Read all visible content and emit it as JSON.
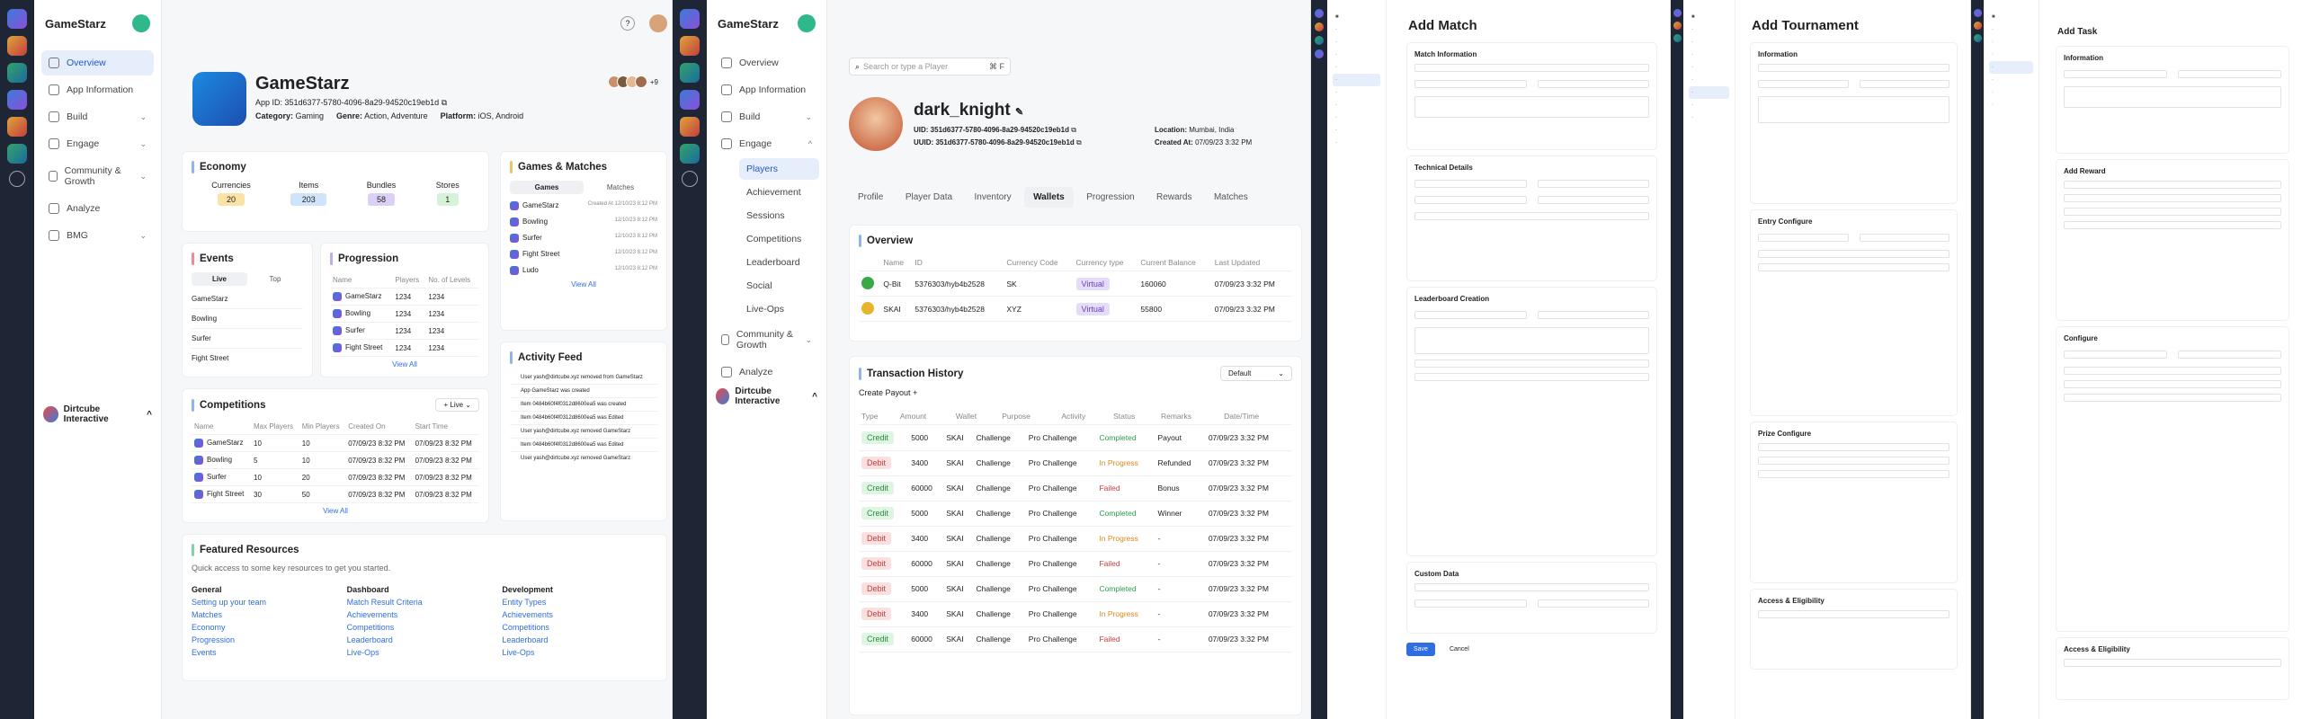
{
  "s1": {
    "brand": "GameStarz",
    "nav": [
      "Overview",
      "App Information",
      "Build",
      "Engage",
      "Community & Growth",
      "Analyze",
      "BMG"
    ],
    "footer": "Dirtcube Interactive",
    "app": {
      "name": "GameStarz",
      "app_id": "App ID: 351d6377-5780-4096-8a29-94520c19eb1d",
      "category_label": "Category:",
      "category": "Gaming",
      "genre_label": "Genre:",
      "genre": "Action, Adventure",
      "platform_label": "Platform:",
      "platform": "iOS, Android",
      "avatars_more": "+9"
    },
    "economy": {
      "title": "Economy",
      "items": [
        {
          "label": "Currencies",
          "value": "20",
          "color": "#fbe3a8"
        },
        {
          "label": "Items",
          "value": "203",
          "color": "#cfe4fb"
        },
        {
          "label": "Bundles",
          "value": "58",
          "color": "#ddd0f7"
        },
        {
          "label": "Stores",
          "value": "1",
          "color": "#d6f3d9"
        }
      ]
    },
    "games": {
      "title": "Games & Matches",
      "tabs": [
        "Games",
        "Matches"
      ],
      "rows": [
        "GameStarz",
        "Bowling",
        "Surfer",
        "Fight Street",
        "Ludo"
      ],
      "dates": [
        "Created At 12/10/23 8:12 PM",
        "12/10/23 8:12 PM",
        "12/10/23 8:12 PM",
        "12/10/23 8:12 PM",
        "12/10/23 8:12 PM"
      ],
      "view_all": "View All"
    },
    "events": {
      "title": "Events",
      "tabs": [
        "Live",
        "Top"
      ],
      "rows": [
        "GameStarz",
        "Bowling",
        "Surfer",
        "Fight Street"
      ]
    },
    "progression": {
      "title": "Progression",
      "cols": [
        "Name",
        "Players",
        "No. of Levels"
      ],
      "rows": [
        [
          "GameStarz",
          "1234",
          "1234"
        ],
        [
          "Bowling",
          "1234",
          "1234"
        ],
        [
          "Surfer",
          "1234",
          "1234"
        ],
        [
          "Fight Street",
          "1234",
          "1234"
        ]
      ],
      "view_all": "View All"
    },
    "activity": {
      "title": "Activity Feed",
      "rows": [
        "User yash@dirtcube.xyz removed from GameStarz",
        "App GameStarz was created",
        "Item 0484b60f4f0312d8600ea5 was created",
        "Item 0484b60f4f0312d8600ea5 was Edited",
        "User yash@dirtcube.xyz removed GameStarz",
        "Item 0484b60f4f0312d8600ea5 was Edited",
        "User yash@dirtcube.xyz removed GameStarz"
      ]
    },
    "competitions": {
      "title": "Competitions",
      "filter": "Live",
      "cols": [
        "Name",
        "Max Players",
        "Min Players",
        "Created On",
        "Start Time"
      ],
      "rows": [
        [
          "GameStarz",
          "10",
          "10",
          "07/09/23 8:32 PM",
          "07/09/23 8:32 PM"
        ],
        [
          "Bowling",
          "5",
          "10",
          "07/09/23 8:32 PM",
          "07/09/23 8:32 PM"
        ],
        [
          "Surfer",
          "10",
          "20",
          "07/09/23 8:32 PM",
          "07/09/23 8:32 PM"
        ],
        [
          "Fight Street",
          "30",
          "50",
          "07/09/23 8:32 PM",
          "07/09/23 8:32 PM"
        ]
      ],
      "view_all": "View All"
    },
    "featured": {
      "title": "Featured Resources",
      "subtitle": "Quick access to some key resources to get you started.",
      "cols": [
        {
          "h": "General",
          "links": [
            "Setting up your team",
            "Matches",
            "Economy",
            "Progression",
            "Events"
          ]
        },
        {
          "h": "Dashboard",
          "links": [
            "Match Result Criteria",
            "Achievements",
            "Competitions",
            "Leaderboard",
            "Live-Ops"
          ]
        },
        {
          "h": "Development",
          "links": [
            "Entity Types",
            "Achievements",
            "Competitions",
            "Leaderboard",
            "Live-Ops"
          ]
        }
      ]
    }
  },
  "s2": {
    "brand": "GameStarz",
    "nav": [
      "Overview",
      "App Information",
      "Build",
      "Engage",
      "Players",
      "Achievement",
      "Sessions",
      "Competitions",
      "Leaderboard",
      "Social",
      "Live-Ops",
      "Community & Growth",
      "Analyze"
    ],
    "footer": "Dirtcube Interactive",
    "search_placeholder": "Search or type a Player",
    "search_kbd": "⌘ F",
    "player": {
      "name": "dark_knight",
      "uid": "UID: 351d6377-5780-4096-8a29-94520c19eb1d",
      "uuid": "UUID: 351d6377-5780-4096-8a29-94520c19eb1d",
      "location_label": "Location:",
      "location": "Mumbai, India",
      "created_label": "Created At:",
      "created": "07/09/23 3:32 PM"
    },
    "tabs": [
      "Profile",
      "Player Data",
      "Inventory",
      "Wallets",
      "Progression",
      "Rewards",
      "Matches"
    ],
    "overview": {
      "title": "Overview",
      "cols": [
        "Name",
        "ID",
        "Currency Code",
        "Currency type",
        "Current Balance",
        "Last Updated"
      ],
      "rows": [
        [
          "Q-Bit",
          "5376303/hyb4b2528",
          "SK",
          "Virtual",
          "160060",
          "07/09/23 3:32 PM"
        ],
        [
          "SKAI",
          "5376303/hyb4b2528",
          "XYZ",
          "Virtual",
          "55800",
          "07/09/23 3:32 PM"
        ]
      ]
    },
    "history": {
      "title": "Transaction History",
      "filter": "Default",
      "create": "Create Payout",
      "cols": [
        "Type",
        "Amount",
        "Wallet",
        "Purpose",
        "Activity",
        "Status",
        "Remarks",
        "Date/Time"
      ],
      "rows": [
        [
          "Credit",
          "5000",
          "SKAI",
          "Challenge",
          "Pro Challenge",
          "Completed",
          "Payout",
          "07/09/23 3:32 PM"
        ],
        [
          "Debit",
          "3400",
          "SKAI",
          "Challenge",
          "Pro Challenge",
          "In Progress",
          "Refunded",
          "07/09/23 3:32 PM"
        ],
        [
          "Credit",
          "60000",
          "SKAI",
          "Challenge",
          "Pro Challenge",
          "Failed",
          "Bonus",
          "07/09/23 3:32 PM"
        ],
        [
          "Credit",
          "5000",
          "SKAI",
          "Challenge",
          "Pro Challenge",
          "Completed",
          "Winner",
          "07/09/23 3:32 PM"
        ],
        [
          "Debit",
          "3400",
          "SKAI",
          "Challenge",
          "Pro Challenge",
          "In Progress",
          "-",
          "07/09/23 3:32 PM"
        ],
        [
          "Debit",
          "60000",
          "SKAI",
          "Challenge",
          "Pro Challenge",
          "Failed",
          "-",
          "07/09/23 3:32 PM"
        ],
        [
          "Debit",
          "5000",
          "SKAI",
          "Challenge",
          "Pro Challenge",
          "Completed",
          "-",
          "07/09/23 3:32 PM"
        ],
        [
          "Debit",
          "3400",
          "SKAI",
          "Challenge",
          "Pro Challenge",
          "In Progress",
          "-",
          "07/09/23 3:32 PM"
        ],
        [
          "Credit",
          "60000",
          "SKAI",
          "Challenge",
          "Pro Challenge",
          "Failed",
          "-",
          "07/09/23 3:32 PM"
        ]
      ]
    }
  },
  "s3": {
    "title": "Add Match",
    "sections": [
      "Match Information",
      "Technical Details",
      "Leaderboard Creation",
      "Custom Data"
    ],
    "submit": "Save",
    "cancel": "Cancel"
  },
  "s4": {
    "title": "Add Tournament",
    "sections": [
      "Information",
      "Entry Configure",
      "Prize Configure",
      "Access & Eligibility"
    ]
  },
  "s5": {
    "title": "Add Task",
    "sections": [
      "Information",
      "Add Reward",
      "Configure",
      "Access & Eligibility"
    ]
  }
}
